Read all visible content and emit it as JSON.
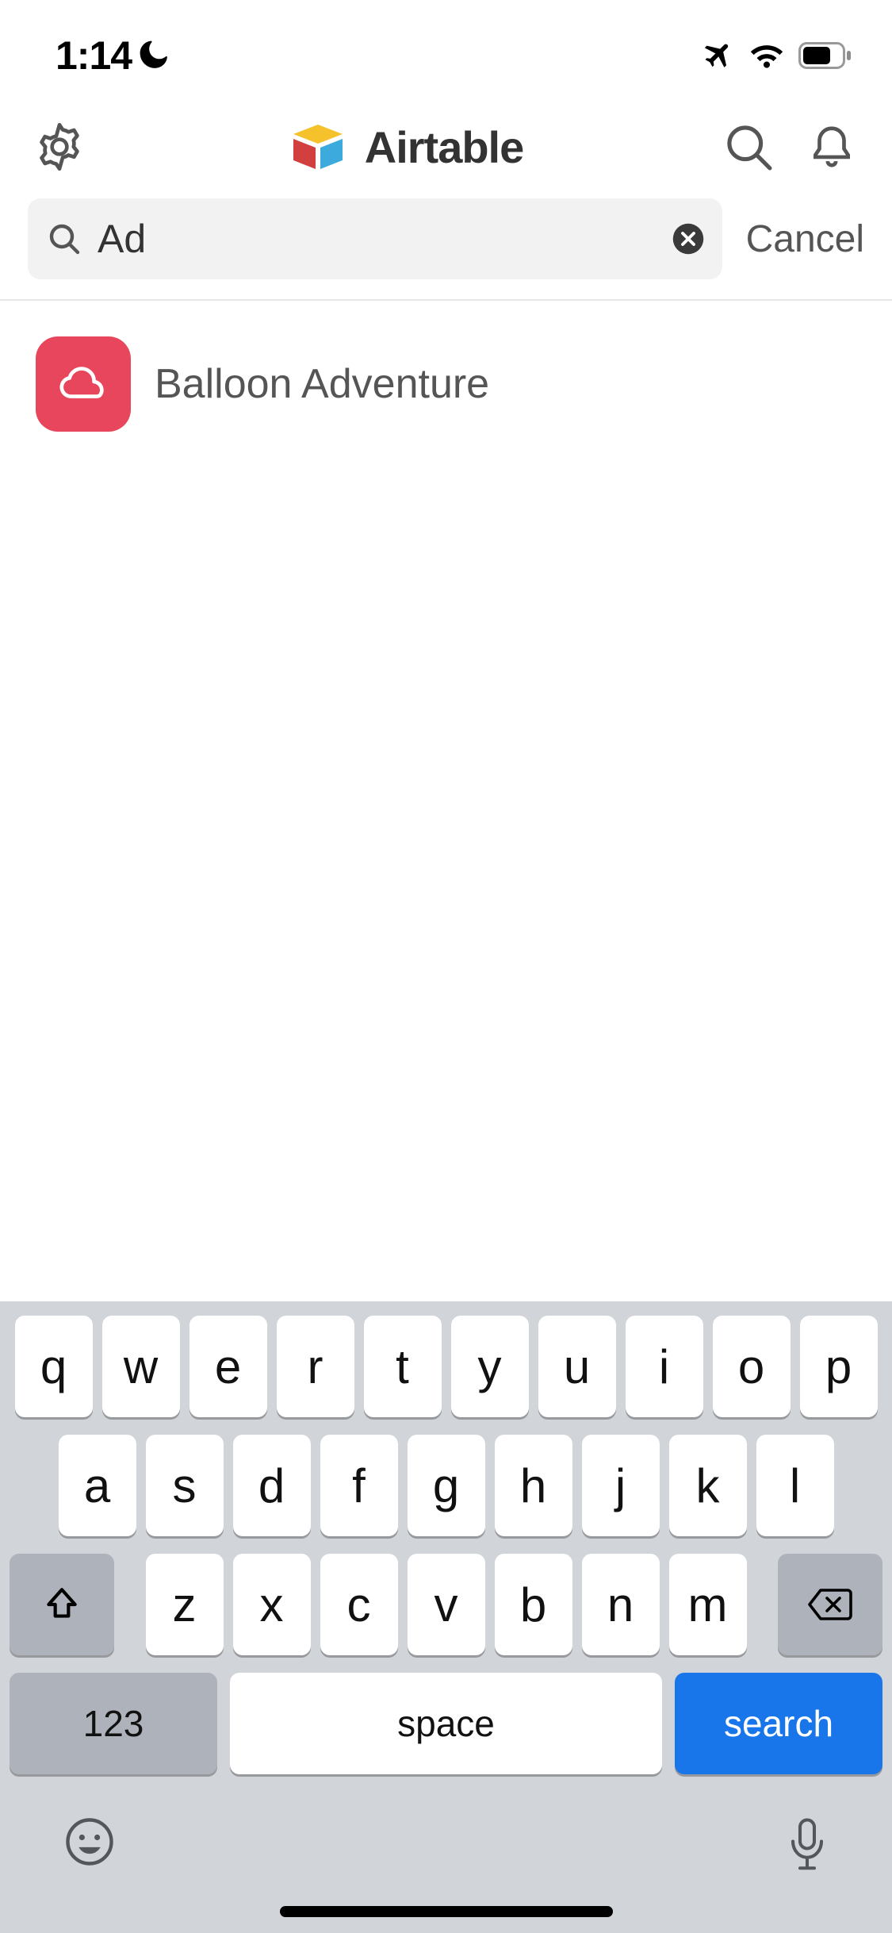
{
  "status": {
    "time": "1:14"
  },
  "brand": {
    "name": "Airtable"
  },
  "search": {
    "value": "Ad",
    "cancel_label": "Cancel"
  },
  "results": [
    {
      "label": "Balloon Adventure",
      "icon": "cloud-icon",
      "color": "#e8465c"
    }
  ],
  "keyboard": {
    "row1": [
      "q",
      "w",
      "e",
      "r",
      "t",
      "y",
      "u",
      "i",
      "o",
      "p"
    ],
    "row2": [
      "a",
      "s",
      "d",
      "f",
      "g",
      "h",
      "j",
      "k",
      "l"
    ],
    "row3": [
      "z",
      "x",
      "c",
      "v",
      "b",
      "n",
      "m"
    ],
    "numbers_label": "123",
    "space_label": "space",
    "search_label": "search"
  }
}
